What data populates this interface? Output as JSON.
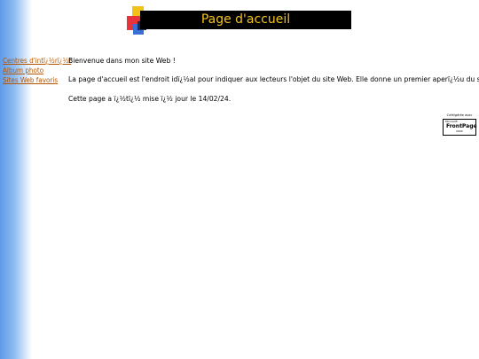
{
  "banner": {
    "title": "Page d'accueil",
    "bg_color": "#000000",
    "text_color": "#f2c21b"
  },
  "nav": {
    "items": [
      {
        "label": "Centres d'intï¿½rï¿½t"
      },
      {
        "label": "Album photo"
      },
      {
        "label": "Sites Web favoris"
      }
    ],
    "link_color": "#b35400"
  },
  "content": {
    "welcome": "Bienvenue dans mon site Web !",
    "description": "La page d'accueil est l'endroit idï¿½al pour indiquer aux lecteurs l'objet du site Web. Elle donne un premier aperï¿½u du style de votre site Web.",
    "updated": "Cette page a ï¿½tï¿½ mise ï¿½ jour le 14/02/24."
  },
  "badge": {
    "caption": "Créé/gérée avec",
    "maker": "Microsoft",
    "brand": "FrontPage",
    "year": "2000"
  },
  "theme": {
    "left_band_color": "#5f9be8"
  }
}
